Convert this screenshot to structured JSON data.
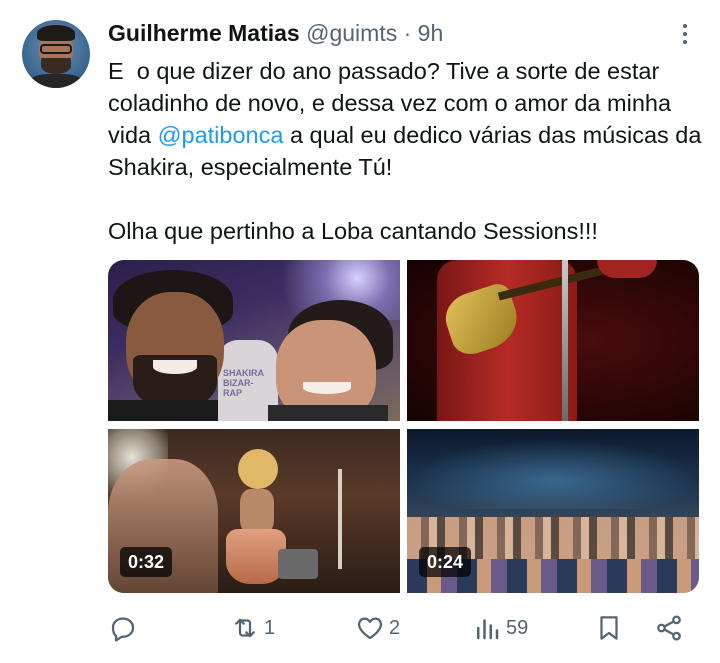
{
  "tweet": {
    "author_name": "Guilherme Matias",
    "handle": "@guimts",
    "separator": "·",
    "time": "9h",
    "text_part1": "E  o que dizer do ano passado? Tive a sorte de estar coladinho de novo, e dessa vez com o amor da minha vida ",
    "mention": "@patibonca",
    "text_part2": " a qual eu dedico várias das músicas da Shakira, especialmente Tú!\n\nOlha que pertinho a Loba cantando Sessions!!!"
  },
  "media": {
    "photo1_shirt_text": "SHAKIRA BIZAR-RAP",
    "video1_duration": "0:32",
    "video2_duration": "0:24"
  },
  "actions": {
    "reply_icon": "reply-icon",
    "retweet_icon": "retweet-icon",
    "retweet_count": "1",
    "like_icon": "heart-icon",
    "like_count": "2",
    "views_icon": "bar-chart-icon",
    "views_count": "59",
    "bookmark_icon": "bookmark-icon",
    "share_icon": "share-icon"
  },
  "colors": {
    "text": "#0f1419",
    "secondary": "#536471",
    "link": "#1d9bf0"
  }
}
